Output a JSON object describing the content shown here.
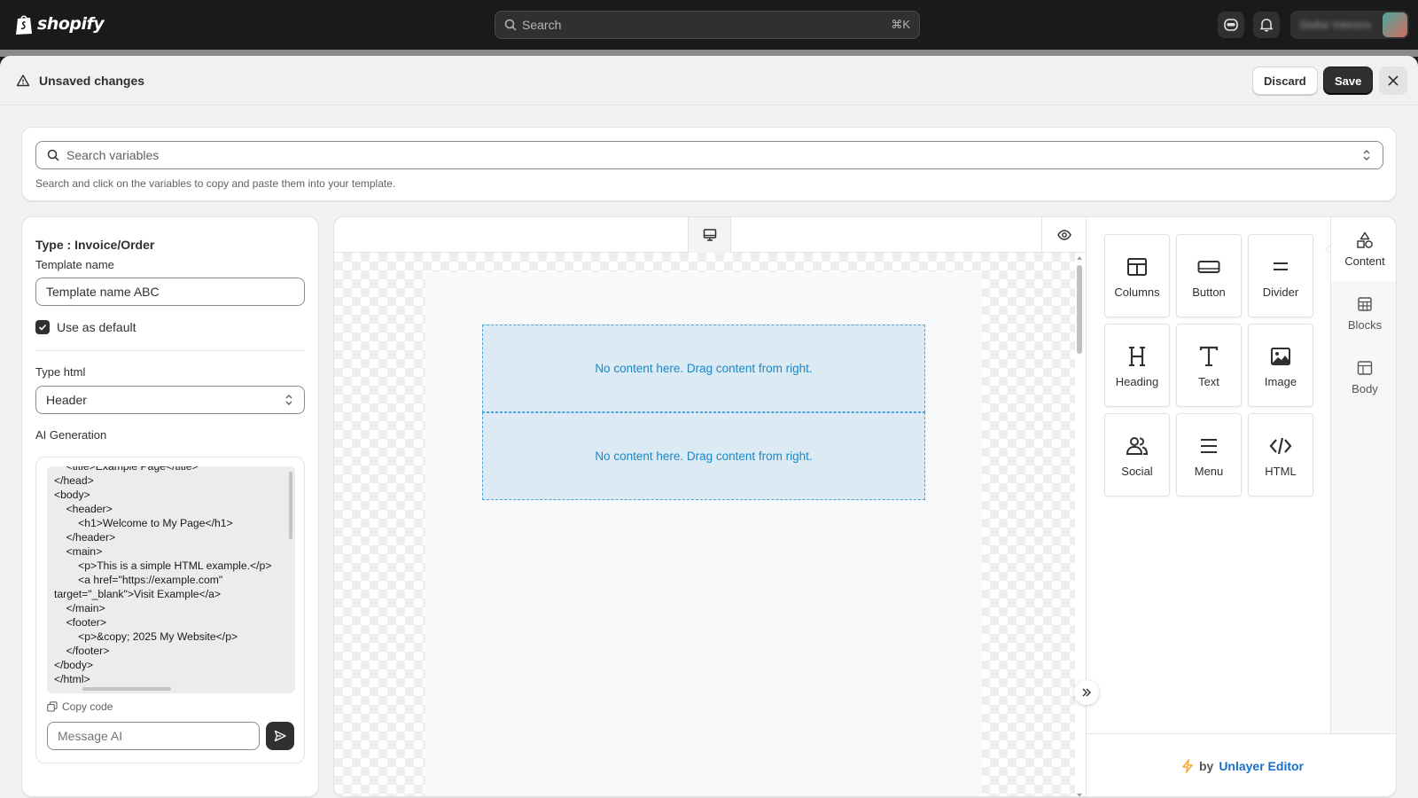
{
  "topbar": {
    "brand": "shopify",
    "search_placeholder": "Search",
    "search_shortcut": "⌘K",
    "store_name": "Stellar Interiors"
  },
  "unsaved": {
    "title": "Unsaved changes",
    "discard_label": "Discard",
    "save_label": "Save"
  },
  "variables": {
    "search_placeholder": "Search variables",
    "help_text": "Search and click on the variables to copy and paste them into your template."
  },
  "template": {
    "type_label": "Type : Invoice/Order",
    "name_label": "Template name",
    "name_value": "Template name ABC",
    "use_default_label": "Use as default",
    "use_default_checked": true,
    "type_html_label": "Type html",
    "type_html_value": "Header",
    "ai_label": "AI Generation",
    "code": "    <title>Example Page</title>\n</head>\n<body>\n    <header>\n        <h1>Welcome to My Page</h1>\n    </header>\n    <main>\n        <p>This is a simple HTML example.</p>\n        <a href=\"https://example.com\"\ntarget=\"_blank\">Visit Example</a>\n    </main>\n    <footer>\n        <p>&copy; 2025 My Website</p>\n    </footer>\n</body>\n</html>",
    "copy_code_label": "Copy code",
    "message_placeholder": "Message AI"
  },
  "canvas": {
    "empty_row_1": "No content here. Drag content from right.",
    "empty_row_2": "No content here. Drag content from right."
  },
  "tools": [
    {
      "label": "Columns",
      "icon": "columns-icon"
    },
    {
      "label": "Button",
      "icon": "button-icon"
    },
    {
      "label": "Divider",
      "icon": "divider-icon"
    },
    {
      "label": "Heading",
      "icon": "heading-icon"
    },
    {
      "label": "Text",
      "icon": "text-icon"
    },
    {
      "label": "Image",
      "icon": "image-icon"
    },
    {
      "label": "Social",
      "icon": "social-icon"
    },
    {
      "label": "Menu",
      "icon": "menu-icon"
    },
    {
      "label": "HTML",
      "icon": "html-icon"
    }
  ],
  "side_tabs": [
    {
      "label": "Content",
      "icon": "shapes-icon",
      "active": true
    },
    {
      "label": "Blocks",
      "icon": "blocks-icon",
      "active": false
    },
    {
      "label": "Body",
      "icon": "body-layout-icon",
      "active": false
    }
  ],
  "powered": {
    "by": "by",
    "name": "Unlayer Editor"
  },
  "colors": {
    "topbar_bg": "#1a1a1a",
    "primary_button": "#303030",
    "dropzone_bg": "#dbeaf3",
    "dropzone_text": "#1a88c9",
    "unlayer_link": "#1a6fc9",
    "bolt": "#f5a524"
  }
}
